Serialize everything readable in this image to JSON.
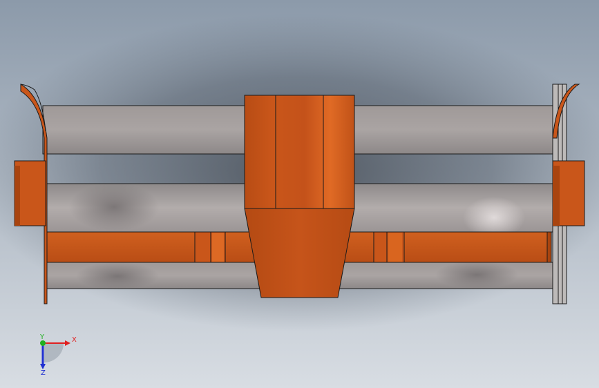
{
  "viewport": {
    "background_top": "#8c9aaa",
    "background_bottom": "#d8dde3",
    "shadow_color": "#3f464f"
  },
  "model": {
    "orange": "#c9561a",
    "orange_light": "#e06a25",
    "orange_dark": "#a9440f",
    "grey": "#a59f9e",
    "grey_light": "#c3bcbc",
    "grey_dark": "#7f7b7c"
  },
  "triad": {
    "x_label": "X",
    "y_label": "Y",
    "z_label": "Z",
    "x_color": "#e02020",
    "y_color": "#20b020",
    "z_color": "#2030d0"
  }
}
